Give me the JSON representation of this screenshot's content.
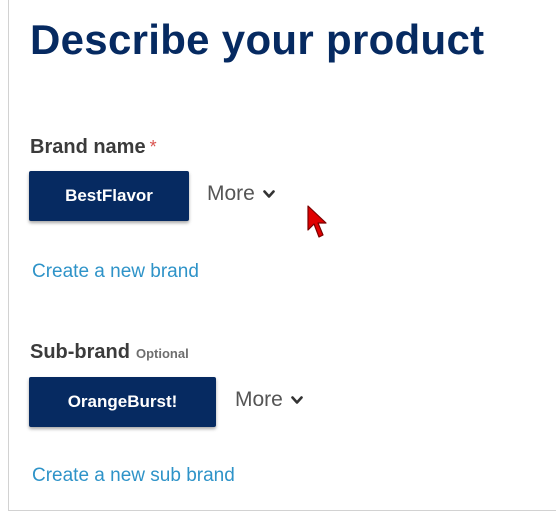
{
  "page": {
    "title": "Describe your product"
  },
  "brand": {
    "label": "Brand name",
    "required_marker": "*",
    "selected": "BestFlavor",
    "more_label": "More",
    "create_link": "Create a new brand"
  },
  "sub_brand": {
    "label": "Sub-brand",
    "optional_label": "Optional",
    "selected": "OrangeBurst!",
    "more_label": "More",
    "create_link": "Create a new sub brand"
  },
  "icons": {
    "more": "chevron-down-icon",
    "cursor": "mouse-pointer-icon"
  },
  "colors": {
    "primary": "#062a61",
    "link": "#2e93c8",
    "required": "#d9534f",
    "cursor": "#e00000"
  }
}
